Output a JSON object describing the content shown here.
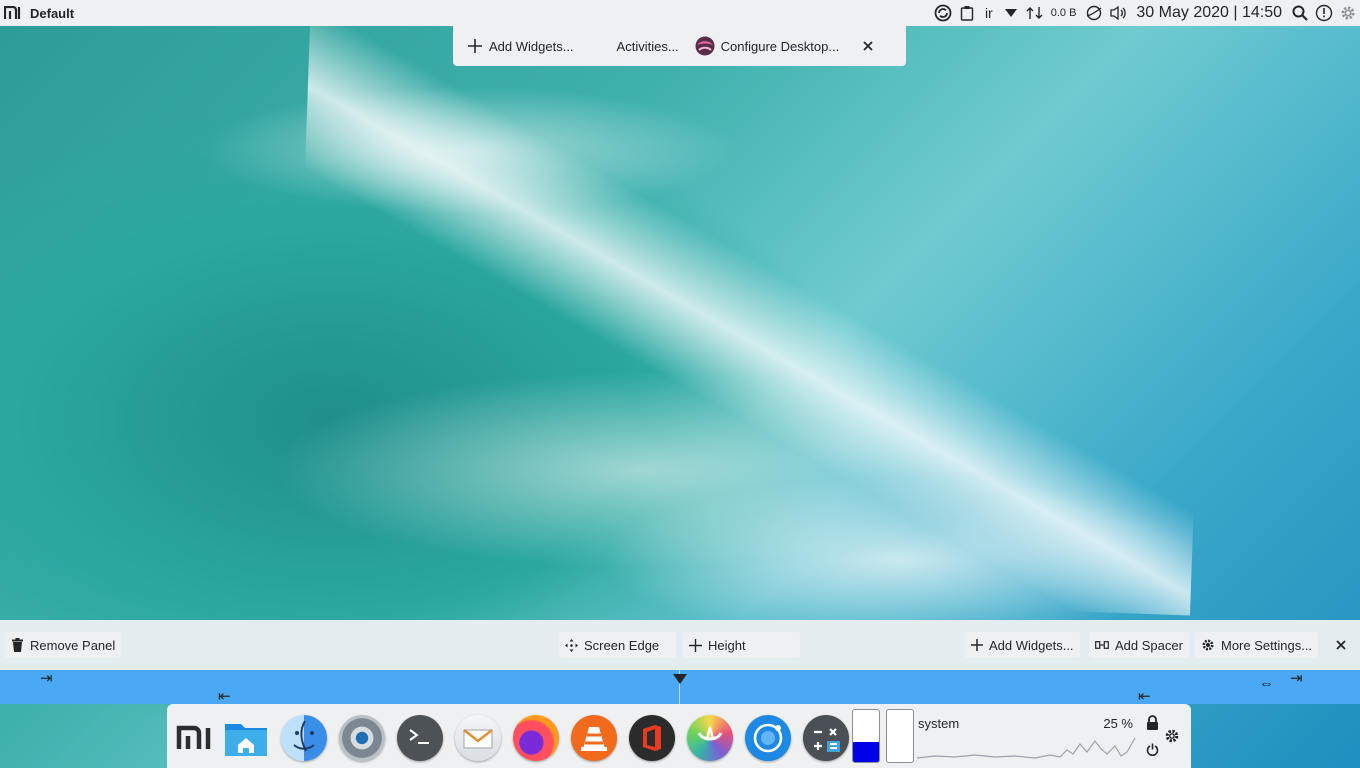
{
  "top_panel": {
    "title": "Default",
    "keyboard_layout": "ir",
    "network_rate": "0.0 B",
    "clock": "30 May 2020 | 14:50"
  },
  "desktop_toolbox": {
    "add_widgets": "Add Widgets...",
    "activities": "Activities...",
    "configure_desktop": "Configure Desktop..."
  },
  "panel_config": {
    "remove_panel": "Remove Panel",
    "screen_edge": "Screen Edge",
    "height": "Height",
    "add_widgets": "Add Widgets...",
    "add_spacer": "Add Spacer",
    "more_settings": "More Settings..."
  },
  "dock": {
    "apps": [
      {
        "name": "xiaomi-logo"
      },
      {
        "name": "files"
      },
      {
        "name": "finder"
      },
      {
        "name": "system-settings"
      },
      {
        "name": "terminal"
      },
      {
        "name": "mail"
      },
      {
        "name": "firefox"
      },
      {
        "name": "vlc"
      },
      {
        "name": "office"
      },
      {
        "name": "krita"
      },
      {
        "name": "web-browser"
      },
      {
        "name": "calculator"
      }
    ],
    "battery_levels": [
      0.38,
      0
    ],
    "system_monitor": {
      "label": "system",
      "value": "25 %"
    }
  },
  "colors": {
    "panel_bg": "#eff0f1",
    "ruler": "#4ba8f5",
    "config_bar": "#e3ecef",
    "battery_fill": "#0000e8"
  }
}
